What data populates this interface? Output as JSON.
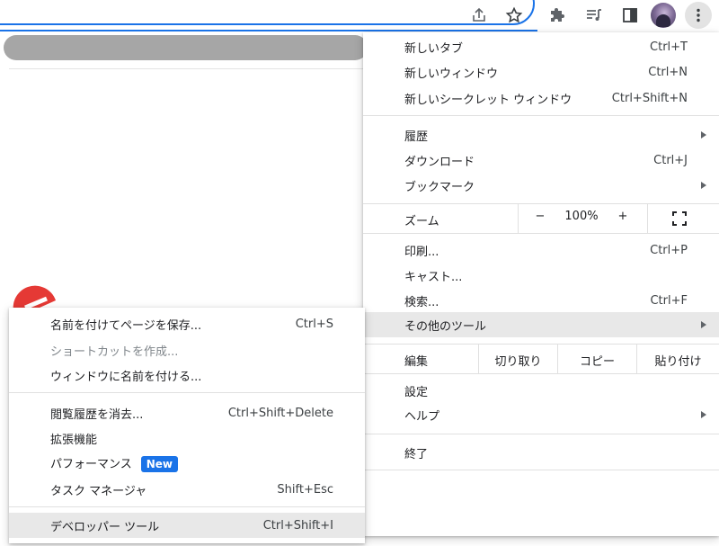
{
  "toolbar": {
    "icons": [
      "share-icon",
      "star-icon",
      "extensions-icon",
      "reading-list-icon",
      "side-panel-icon",
      "profile-avatar",
      "more-vert-icon"
    ]
  },
  "colors": {
    "accent": "#1a73e8",
    "highlight": "#e8e8e8",
    "redaction": "#a6a6a6",
    "logo": "#e53935"
  },
  "main_menu": {
    "new_tab": {
      "label": "新しいタブ",
      "accel": "Ctrl+T"
    },
    "new_window": {
      "label": "新しいウィンドウ",
      "accel": "Ctrl+N"
    },
    "new_incognito": {
      "label": "新しいシークレット ウィンドウ",
      "accel": "Ctrl+Shift+N"
    },
    "history": {
      "label": "履歴"
    },
    "downloads": {
      "label": "ダウンロード",
      "accel": "Ctrl+J"
    },
    "bookmarks": {
      "label": "ブックマーク"
    },
    "zoom": {
      "label": "ズーム",
      "minus": "−",
      "value": "100%",
      "plus": "+"
    },
    "print": {
      "label": "印刷...",
      "accel": "Ctrl+P"
    },
    "cast": {
      "label": "キャスト..."
    },
    "find": {
      "label": "検索...",
      "accel": "Ctrl+F"
    },
    "more_tools": {
      "label": "その他のツール"
    },
    "edit": {
      "label": "編集",
      "cut": "切り取り",
      "copy": "コピー",
      "paste": "貼り付け"
    },
    "settings": {
      "label": "設定"
    },
    "help": {
      "label": "ヘルプ"
    },
    "exit": {
      "label": "終了"
    }
  },
  "sub_menu": {
    "save_page": {
      "label": "名前を付けてページを保存...",
      "accel": "Ctrl+S"
    },
    "create_shortcut": {
      "label": "ショートカットを作成..."
    },
    "name_window": {
      "label": "ウィンドウに名前を付ける..."
    },
    "clear_data": {
      "label": "閲覧履歴を消去...",
      "accel": "Ctrl+Shift+Delete"
    },
    "extensions": {
      "label": "拡張機能"
    },
    "performance": {
      "label": "パフォーマンス",
      "badge": "New"
    },
    "task_manager": {
      "label": "タスク マネージャ",
      "accel": "Shift+Esc"
    },
    "developer_tools": {
      "label": "デベロッパー ツール",
      "accel": "Ctrl+Shift+I"
    }
  }
}
